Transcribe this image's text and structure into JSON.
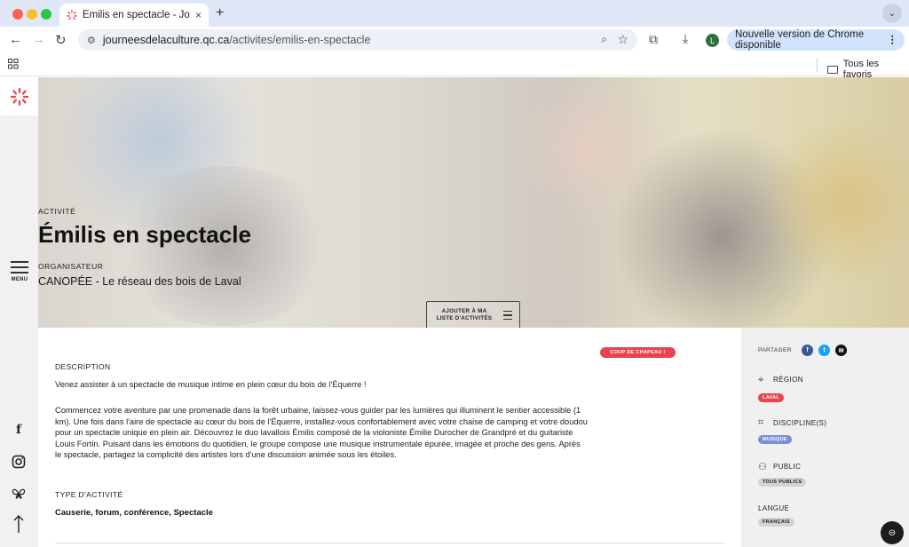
{
  "browser": {
    "tab_title": "Émilis en spectacle - Journée…",
    "tab_close": "×",
    "new_tab": "+",
    "tab_menu": "⌄",
    "url_domain": "journeesdelaculture.qc.ca",
    "url_path": "/activites/emilis-en-spectacle",
    "profile_initial": "L",
    "update_chip": "Nouvelle version de Chrome disponible",
    "update_menu": "⋮",
    "all_bookmarks": "Tous les favoris",
    "colors": {
      "tab_strip": "#dfe7f7",
      "update_chip": "#d3e3fd"
    }
  },
  "rail": {
    "menu_label": "MENU",
    "icons": [
      "facebook-icon",
      "instagram-icon",
      "butterfly-icon",
      "arrow-up-icon"
    ]
  },
  "hero": {
    "kicker": "ACTIVITÉ",
    "title": "Émilis en spectacle",
    "org_label": "ORGANISATEUR",
    "org_name": "CANOPÉE - Le réseau des bois de Laval",
    "add_button": "AJOUTER À MA LISTE D'ACTIVITÉS"
  },
  "main": {
    "badge": "COUP DE CHAPEAU !",
    "description_label": "DESCRIPTION",
    "intro": "Venez assister à un spectacle de musique intime en plein cœur du bois de l'Équerre !",
    "body": "Commencez votre aventure par une promenade dans la forêt urbaine, laissez-vous guider par les lumières qui illuminent le sentier accessible (1 km). Une fois dans l'aire de spectacle au cœur du bois de l'Équerre, installez-vous confortablement avec votre chaise de camping et votre doudou pour un spectacle unique en plein air. Découvrez le duo lavallois Émilis composé de la violoniste Émilie Durocher de Grandpré et du guitariste Louis Fortin. Puisant dans les émotions du quotidien, le groupe compose une musique instrumentale épurée, imagée et proche des gens. Après le spectacle, partagez la complicité des artistes lors d'une discussion animée sous les étoiles.",
    "type_label": "TYPE D'ACTIVITÉ",
    "types": "Causerie, forum, conférence, Spectacle"
  },
  "side": {
    "share_label": "PARTAGER",
    "region_title": "RÉGION",
    "region_tag": "LAVAL",
    "discipline_title": "DISCIPLINE(S)",
    "discipline_tag": "MUSIQUE",
    "public_title": "PUBLIC",
    "public_tag": "TOUS PUBLICS",
    "language_title": "LANGUE",
    "language_tag": "FRANÇAIS",
    "colors": {
      "region": "#e8434f",
      "discipline": "#7b8fd6",
      "neutral": "#d3d3d3",
      "facebook": "#3b5998",
      "twitter": "#1da1f2",
      "email": "#111111"
    }
  }
}
